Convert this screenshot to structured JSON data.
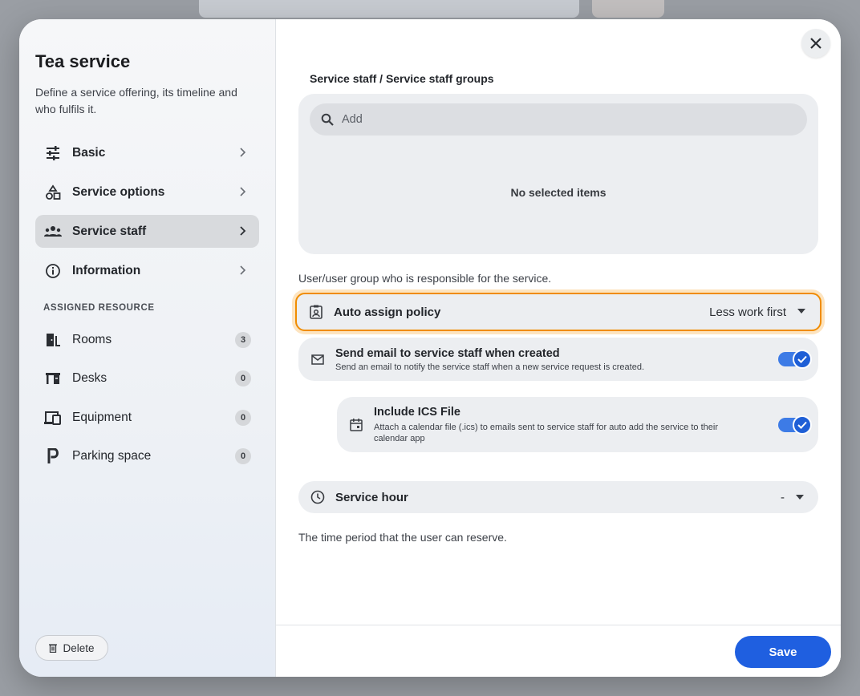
{
  "colors": {
    "accent": "#1f5fe0",
    "focus_outline": "#f08c00",
    "toggle_on": "#3d7be6"
  },
  "sidebar": {
    "title": "Tea service",
    "description": "Define a service offering, its timeline and who fulfils it.",
    "nav": [
      {
        "label": "Basic",
        "icon": "sliders-icon"
      },
      {
        "label": "Service options",
        "icon": "shapes-icon"
      },
      {
        "label": "Service staff",
        "icon": "people-icon",
        "active": true
      },
      {
        "label": "Information",
        "icon": "info-icon"
      }
    ],
    "section_label": "ASSIGNED RESOURCE",
    "resources": [
      {
        "label": "Rooms",
        "count": "3",
        "icon": "door-icon"
      },
      {
        "label": "Desks",
        "count": "0",
        "icon": "desk-icon"
      },
      {
        "label": "Equipment",
        "count": "0",
        "icon": "devices-icon"
      },
      {
        "label": "Parking space",
        "count": "0",
        "icon": "parking-icon"
      }
    ],
    "delete_label": "Delete"
  },
  "main": {
    "staff_title": "Service staff / Service staff groups",
    "search_placeholder": "Add",
    "empty_text": "No selected items",
    "staff_help": "User/user group who is responsible for the service.",
    "policy": {
      "label": "Auto assign policy",
      "value": "Less work first"
    },
    "email": {
      "title": "Send email to service staff when created",
      "subtitle": "Send an email to notify the service staff when a new service request is created.",
      "enabled": true
    },
    "ics": {
      "title": "Include ICS File",
      "subtitle": "Attach a calendar file (.ics) to emails sent to service staff for auto add the service to their calendar app",
      "enabled": true
    },
    "hour": {
      "label": "Service hour",
      "value": "-"
    },
    "hour_help": "The time period that the user can reserve.",
    "save_label": "Save"
  }
}
